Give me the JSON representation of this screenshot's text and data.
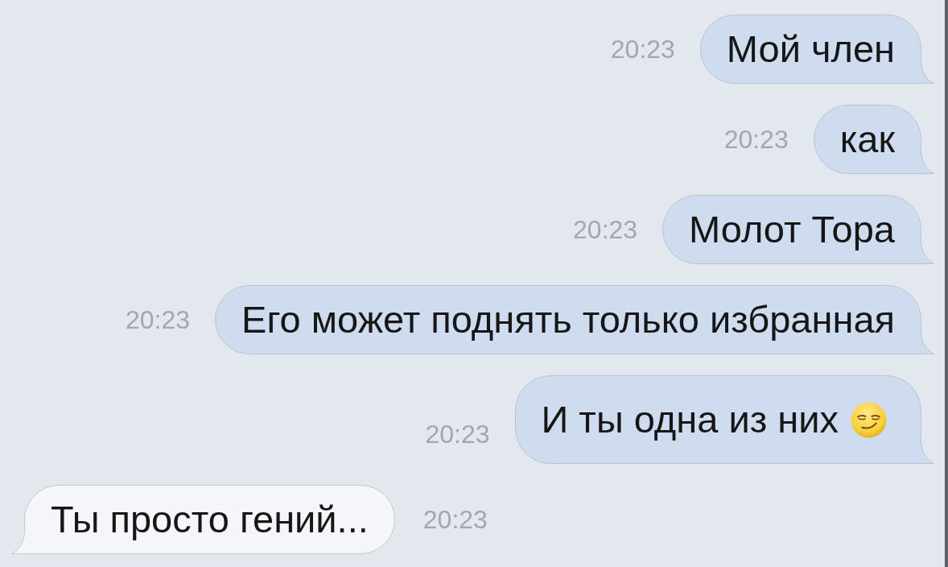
{
  "messages": [
    {
      "kind": "outgoing",
      "time": "20:23",
      "text": "Мой член",
      "emoji": false
    },
    {
      "kind": "outgoing",
      "time": "20:23",
      "text": "как",
      "emoji": false
    },
    {
      "kind": "outgoing",
      "time": "20:23",
      "text": "Молот Тора",
      "emoji": false
    },
    {
      "kind": "outgoing",
      "time": "20:23",
      "text": "Его может поднять только избранная",
      "emoji": false
    },
    {
      "kind": "outgoing",
      "time": "20:23",
      "text": "И ты одна из них",
      "emoji": true
    },
    {
      "kind": "incoming",
      "time": "20:23",
      "text": "Ты просто гений...",
      "emoji": false
    }
  ]
}
